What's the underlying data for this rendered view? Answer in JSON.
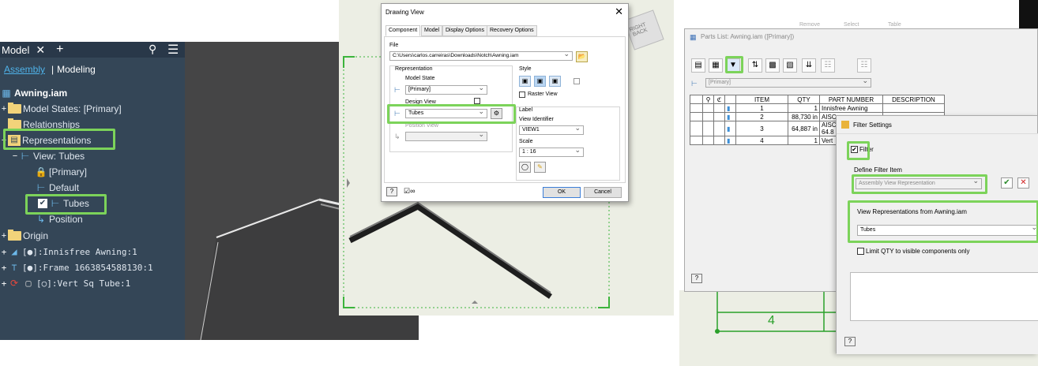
{
  "browser": {
    "tab_label": "Model",
    "tab_close": "✕",
    "tab_add": "+",
    "mode_assembly": "Assembly",
    "mode_separator": "|",
    "mode_modeling": "Modeling",
    "items": [
      {
        "label": "Awning.iam"
      },
      {
        "label": "Model States: [Primary]"
      },
      {
        "label": "Relationships"
      },
      {
        "label": "Representations"
      },
      {
        "label": "View: Tubes"
      },
      {
        "label": "[Primary]"
      },
      {
        "label": "Default"
      },
      {
        "label": "Tubes"
      },
      {
        "label": "Position"
      },
      {
        "label": "Origin"
      },
      {
        "label": "[●]:Innisfree Awning:1"
      },
      {
        "label": "[●]:Frame 1663854588130:1"
      },
      {
        "label": "[○]:Vert Sq Tube:1"
      }
    ]
  },
  "drawing_view": {
    "title": "Drawing View",
    "close": "✕",
    "tabs": [
      "Component",
      "Model",
      "Display Options",
      "Recovery Options"
    ],
    "file_label": "File",
    "file_path": "C:\\Users\\carlos.carreiras\\Downloads\\Notch\\Awning.iam",
    "representation_label": "Representation",
    "model_state_label": "Model State",
    "model_state_value": "[Primary]",
    "design_view_label": "Design View",
    "design_view_value": "Tubes",
    "position_view_label": "Position View",
    "style_label": "Style",
    "raster_view_label": "Raster View",
    "label_group": "Label",
    "view_identifier_label": "View Identifier",
    "view_identifier_value": "VIEW1",
    "scale_label": "Scale",
    "scale_value": "1 : 16",
    "ok": "OK",
    "cancel": "Cancel",
    "help": "?",
    "viewcube_right": "RIGHT",
    "viewcube_back": "BACK"
  },
  "parts_list": {
    "title": "Parts List: Awning.iam ([Primary])",
    "model_state_value": "[Primary]",
    "columns": [
      "ITEM",
      "QTY",
      "PART NUMBER",
      "DESCRIPTION"
    ],
    "rows": [
      {
        "item": "1",
        "qty": "1",
        "part": "Innisfree Awning"
      },
      {
        "item": "2",
        "qty": "88,730 in",
        "part": "AISC"
      },
      {
        "item": "3",
        "qty": "64,887 in",
        "part": "AISC",
        "part2": "64.8"
      },
      {
        "item": "4",
        "qty": "1",
        "part": "Vert"
      }
    ],
    "help": "?",
    "faded_header": [
      "Remove",
      "Select",
      "Table"
    ],
    "drawing_item": "4"
  },
  "filter_settings": {
    "title": "Filter Settings",
    "filter_label": "Filter",
    "define_label": "Define Filter Item",
    "filter_item_value": "Assembly View Representation",
    "view_reps_label": "View Representations from Awning.iam",
    "view_reps_value": "Tubes",
    "limit_label": "Limit QTY to visible components only",
    "help": "?",
    "ok_glyph": "✔",
    "cancel_glyph": "✕"
  },
  "colors": {
    "highlight": "#7cd35a",
    "browser_bg": "#344657",
    "drawing_green": "#2aa02a"
  }
}
